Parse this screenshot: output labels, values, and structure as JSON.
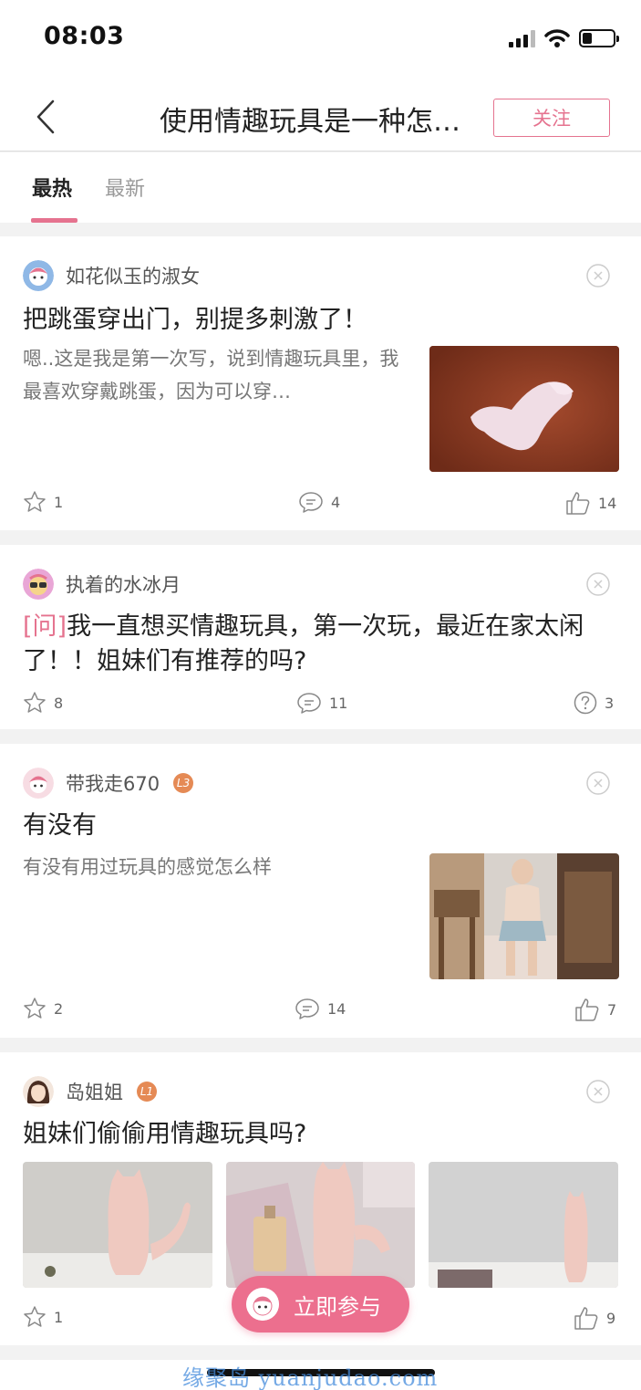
{
  "status_bar": {
    "time": "08:03",
    "battery_level": 0.3
  },
  "nav": {
    "title": "使用情趣玩具是一种怎…",
    "follow_label": "关注",
    "back_icon": "chevron-left-icon"
  },
  "tabs": [
    {
      "label": "最热",
      "active": true
    },
    {
      "label": "最新",
      "active": false
    }
  ],
  "accent_color": "#e5738f",
  "posts": [
    {
      "author": "如花似玉的淑女",
      "level": "",
      "title": "把跳蛋穿出门，别提多刺激了！",
      "excerpt": "嗯..这是我是第一次写，说到情趣玩具里，我最喜欢穿戴跳蛋，因为可以穿…",
      "stats": {
        "favorites": "1",
        "comments": "4",
        "likes": "14"
      }
    },
    {
      "author": "执着的水冰月",
      "level": "",
      "tag": "[问]",
      "title": "我一直想买情趣玩具，第一次玩，最近在家太闲了！！姐妹们有推荐的吗?",
      "stats": {
        "favorites": "8",
        "comments": "11",
        "answers": "3"
      }
    },
    {
      "author": "带我走670",
      "level": "L3",
      "title": "有没有",
      "excerpt": "有没有用过玩具的感觉怎么样",
      "stats": {
        "favorites": "2",
        "comments": "14",
        "likes": "7"
      }
    },
    {
      "author": "岛姐姐",
      "level": "L1",
      "title": "姐妹们偷偷用情趣玩具吗?",
      "stats": {
        "favorites": "1",
        "likes": "9"
      }
    }
  ],
  "cta": {
    "label": "立即参与"
  },
  "watermark": "缘聚岛 yuanjudao.com"
}
